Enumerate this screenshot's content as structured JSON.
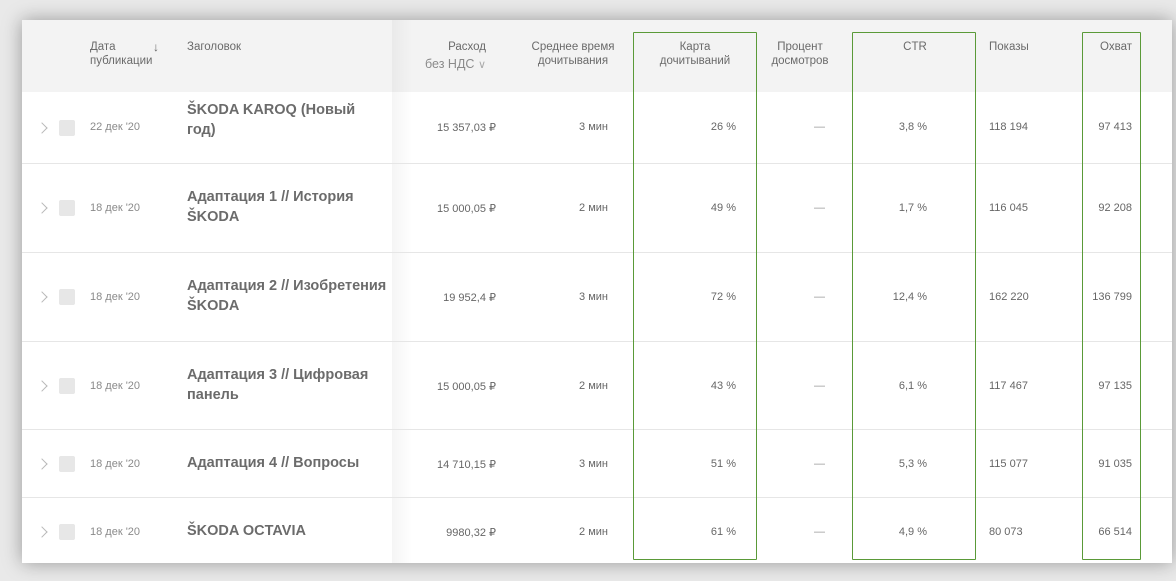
{
  "header": {
    "date_col": "Дата\nпубликации",
    "date_col_line1": "Дата",
    "date_col_line2": "публикации",
    "sort_icon": "↓",
    "title_col": "Заголовок",
    "spend_col_line1": "Расход",
    "spend_col_line2": "без НДС",
    "spend_dropdown_icon": "∨",
    "readtime_col_line1": "Среднее время",
    "readtime_col_line2": "дочитывания",
    "readmap_col_line1": "Карта",
    "readmap_col_line2": "дочитываний",
    "viewpct_col_line1": "Процент",
    "viewpct_col_line2": "досмотров",
    "ctr_col": "CTR",
    "shows_col": "Показы",
    "reach_col": "Охват"
  },
  "rows": [
    {
      "date": "22 дек '20",
      "title": "ŠKODA KAROQ (Новый год)",
      "spend": "15 357,03 ₽",
      "readtime": "3 мин",
      "readmap": "26 %",
      "viewpct": "—",
      "ctr": "3,8 %",
      "shows": "118 194",
      "reach": "97 413"
    },
    {
      "date": "18 дек '20",
      "title": "Адаптация 1 // История ŠKODA",
      "spend": "15 000,05 ₽",
      "readtime": "2 мин",
      "readmap": "49 %",
      "viewpct": "—",
      "ctr": "1,7 %",
      "shows": "116 045",
      "reach": "92 208"
    },
    {
      "date": "18 дек '20",
      "title": "Адаптация 2 // Изобретения ŠKODA",
      "spend": "19 952,4 ₽",
      "readtime": "3 мин",
      "readmap": "72 %",
      "viewpct": "—",
      "ctr": "12,4 %",
      "shows": "162 220",
      "reach": "136 799"
    },
    {
      "date": "18 дек '20",
      "title": "Адаптация 3 // Цифровая панель",
      "spend": "15 000,05 ₽",
      "readtime": "2 мин",
      "readmap": "43 %",
      "viewpct": "—",
      "ctr": "6,1 %",
      "shows": "117 467",
      "reach": "97 135"
    },
    {
      "date": "18 дек '20",
      "title": "Адаптация 4 // Вопросы",
      "spend": "14 710,15 ₽",
      "readtime": "3 мин",
      "readmap": "51 %",
      "viewpct": "—",
      "ctr": "5,3 %",
      "shows": "115 077",
      "reach": "91 035"
    },
    {
      "date": "18 дек '20",
      "title": "ŠKODA OCTAVIA",
      "spend": "9980,32 ₽",
      "readtime": "2 мин",
      "readmap": "61 %",
      "viewpct": "—",
      "ctr": "4,9 %",
      "shows": "80 073",
      "reach": "66 514"
    }
  ],
  "colors": {
    "highlight_frame": "#5a9a38",
    "header_bg": "#f3f3f3"
  }
}
